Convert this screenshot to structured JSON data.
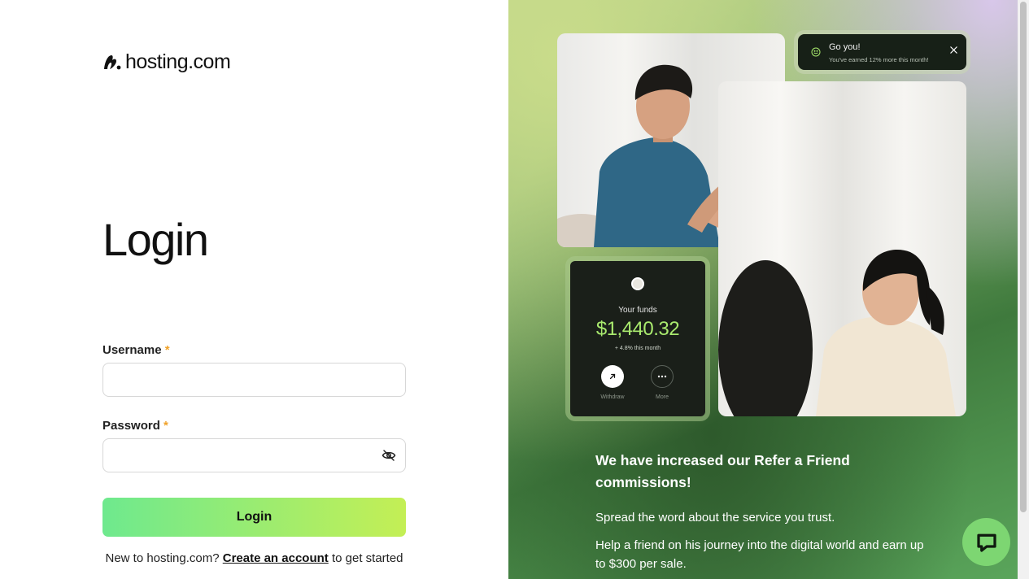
{
  "logo": {
    "text": "hosting.com"
  },
  "form": {
    "title": "Login",
    "username_label": "Username",
    "password_label": "Password",
    "required_mark": "*",
    "username_value": "",
    "password_value": "",
    "submit_label": "Login",
    "signup_prefix": "New to hosting.com?",
    "signup_link": "Create an account",
    "signup_suffix": "to get started"
  },
  "promo": {
    "toast": {
      "title": "Go you!",
      "subtitle": "You've earned 12% more this month!"
    },
    "funds_card": {
      "label": "Your funds",
      "amount": "$1,440.32",
      "change": "+ 4.8% this month",
      "withdraw_label": "Withdraw",
      "more_label": "More"
    },
    "headline": "We have increased our Refer a Friend commissions!",
    "paragraph1": "Spread the word about the service you trust.",
    "paragraph2": "Help a friend on his journey into the digital world and earn up to $300 per sale."
  },
  "icons": {
    "logo": "hosting-logo-icon",
    "password_toggle": "eye-off-icon",
    "toast": "smiley-icon",
    "toast_close": "close-icon",
    "withdraw": "arrow-up-right-icon",
    "more": "more-dots-icon",
    "chat": "chat-bubble-icon"
  },
  "colors": {
    "accent_green": "#a9ea6e",
    "button_gradient_start": "#6ee98e",
    "button_gradient_end": "#c4ef55",
    "required": "#f0a22a",
    "chat_button": "#7dd672"
  }
}
